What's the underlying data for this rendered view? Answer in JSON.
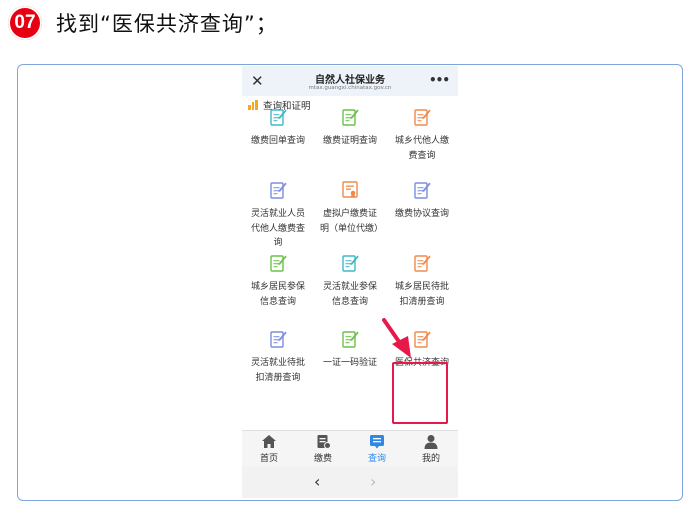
{
  "step": {
    "number": "07",
    "title": "找到“医保共济查询”；"
  },
  "titlebar": {
    "title": "自然人社保业务",
    "url": "mtax.guangxi.chinatax.gov.cn"
  },
  "section": {
    "title": "查询和证明"
  },
  "tiles": [
    {
      "label": "缴费回单查询",
      "color": "#3fb8c6",
      "kind": "doc"
    },
    {
      "label": "缴费证明查询",
      "color": "#6cc04a",
      "kind": "doc"
    },
    {
      "label": "城乡代他人缴费查询",
      "color": "#f08a4b",
      "kind": "doc"
    },
    {
      "label": "灵活就业人员代他人缴费查询",
      "color": "#7b8fe0",
      "kind": "doc"
    },
    {
      "label": "虚拟户缴费证明（单位代缴）",
      "color": "#f08a4b",
      "kind": "cert"
    },
    {
      "label": "缴费协议查询",
      "color": "#7b8fe0",
      "kind": "doc"
    },
    {
      "label": "城乡居民参保信息查询",
      "color": "#6cc04a",
      "kind": "doc"
    },
    {
      "label": "灵活就业参保信息查询",
      "color": "#3fb8c6",
      "kind": "doc"
    },
    {
      "label": "城乡居民待批扣清册查询",
      "color": "#f08a4b",
      "kind": "doc"
    },
    {
      "label": "灵活就业待批扣清册查询",
      "color": "#7b8fe0",
      "kind": "doc"
    },
    {
      "label": "一证一码验证",
      "color": "#6cc04a",
      "kind": "doc"
    },
    {
      "label": "医保共济查询",
      "color": "#f08a4b",
      "kind": "doc"
    }
  ],
  "tabs": [
    {
      "label": "首页",
      "icon": "home-icon"
    },
    {
      "label": "缴费",
      "icon": "payment-icon"
    },
    {
      "label": "查询",
      "icon": "query-icon"
    },
    {
      "label": "我的",
      "icon": "user-icon"
    }
  ],
  "colors": {
    "accent": "#2f88e8",
    "highlight": "#e6194b",
    "badge": "#e60012"
  }
}
